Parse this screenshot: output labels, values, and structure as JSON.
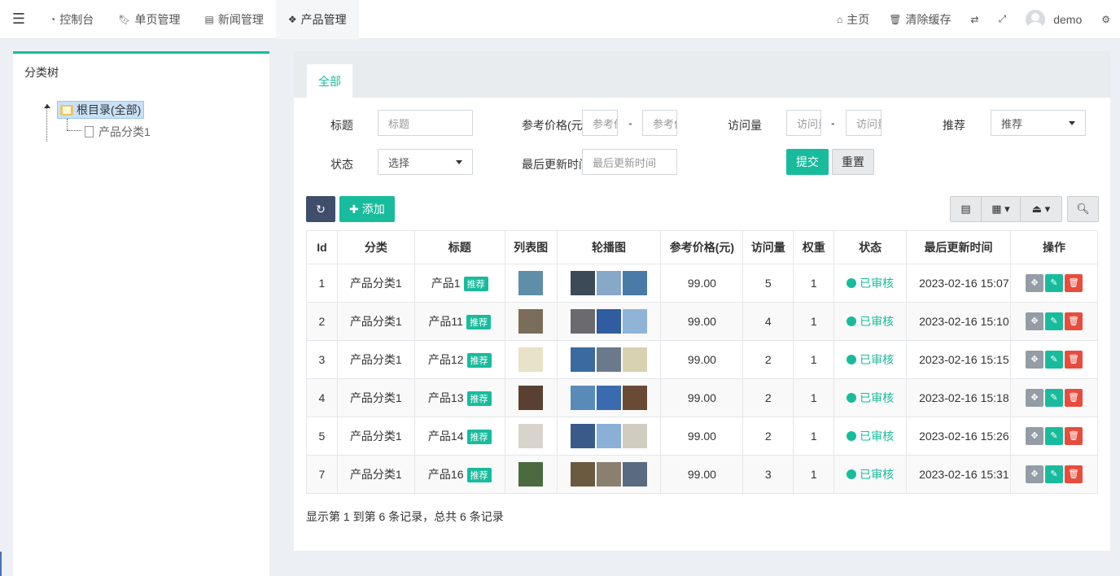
{
  "nav": {
    "items": [
      {
        "label": "控制台",
        "icon": "dashboard-icon"
      },
      {
        "label": "单页管理",
        "icon": "bookmark-icon"
      },
      {
        "label": "新闻管理",
        "icon": "newspaper-icon"
      },
      {
        "label": "产品管理",
        "icon": "cubes-icon"
      }
    ],
    "home": "主页",
    "clear_cache": "清除缓存",
    "user": "demo"
  },
  "tree": {
    "title": "分类树",
    "root": "根目录(全部)",
    "child": "产品分类1"
  },
  "tabs": {
    "all": "全部"
  },
  "filters": {
    "title_label": "标题",
    "title_placeholder": "标题",
    "price_label": "参考价格(元)",
    "price_min_placeholder": "参考价格(元)",
    "price_max_placeholder": "参考价格(元)",
    "views_label": "访问量",
    "views_min_placeholder": "访问量",
    "views_max_placeholder": "访问量",
    "recommend_label": "推荐",
    "recommend_value": "推荐",
    "status_label": "状态",
    "status_value": "选择",
    "updated_label": "最后更新时间",
    "updated_placeholder": "最后更新时间",
    "submit": "提交",
    "reset": "重置",
    "dash": "-"
  },
  "toolbar": {
    "add": "添加"
  },
  "table": {
    "headers": [
      "Id",
      "分类",
      "标题",
      "列表图",
      "轮播图",
      "参考价格(元)",
      "访问量",
      "权重",
      "状态",
      "最后更新时间",
      "操作"
    ],
    "badge": "推荐",
    "rows": [
      {
        "id": "1",
        "category": "产品分类1",
        "title": "产品1",
        "price": "99.00",
        "views": "5",
        "weight": "1",
        "status": "已审核",
        "updated": "2023-02-16 15:07"
      },
      {
        "id": "2",
        "category": "产品分类1",
        "title": "产品11",
        "price": "99.00",
        "views": "4",
        "weight": "1",
        "status": "已审核",
        "updated": "2023-02-16 15:10"
      },
      {
        "id": "3",
        "category": "产品分类1",
        "title": "产品12",
        "price": "99.00",
        "views": "2",
        "weight": "1",
        "status": "已审核",
        "updated": "2023-02-16 15:15"
      },
      {
        "id": "4",
        "category": "产品分类1",
        "title": "产品13",
        "price": "99.00",
        "views": "2",
        "weight": "1",
        "status": "已审核",
        "updated": "2023-02-16 15:18"
      },
      {
        "id": "5",
        "category": "产品分类1",
        "title": "产品14",
        "price": "99.00",
        "views": "2",
        "weight": "1",
        "status": "已审核",
        "updated": "2023-02-16 15:26"
      },
      {
        "id": "7",
        "category": "产品分类1",
        "title": "产品16",
        "price": "99.00",
        "views": "3",
        "weight": "1",
        "status": "已审核",
        "updated": "2023-02-16 15:31"
      }
    ]
  },
  "summary": "显示第 1 到第 6 条记录，总共 6 条记录",
  "colors": {
    "accent": "#18bc9c",
    "danger": "#e74c3c",
    "dark": "#3f4e6a"
  }
}
